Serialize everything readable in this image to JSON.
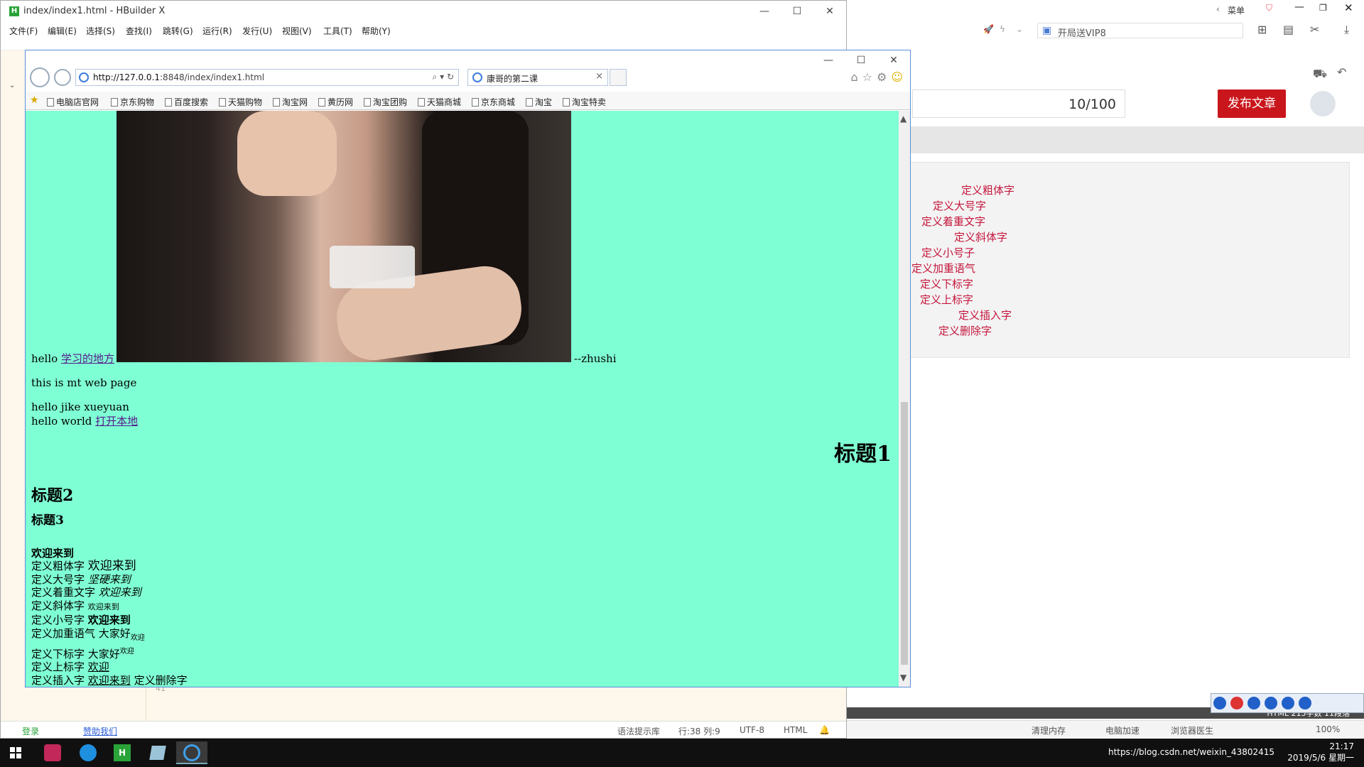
{
  "hbuilder": {
    "title": "index/index1.html - HBuilder X",
    "menu": [
      "文件(F)",
      "编辑(E)",
      "选择(S)",
      "查找(I)",
      "跳转(G)",
      "运行(R)",
      "发行(U)",
      "视图(V)",
      "工具(T)",
      "帮助(Y)"
    ],
    "line_number": "41",
    "status": {
      "login": "登录",
      "support": "赞助我们",
      "hint": "语法提示库",
      "pos": "行:38  列:9",
      "encoding": "UTF-8",
      "lang": "HTML"
    }
  },
  "browser": {
    "url_host": "http://127.0.0.1",
    "url_rest": ":8848/index/index1.html",
    "tab_title": "康哥的第二课",
    "favorites": [
      "电脑店官网",
      "京东购物",
      "百度搜索",
      "天猫购物",
      "淘宝网",
      "黄历网",
      "淘宝团购",
      "天猫商城",
      "京东商城",
      "淘宝",
      "淘宝特卖"
    ]
  },
  "page": {
    "hello": "hello",
    "link_study": "学习的地方",
    "zhushi": "--zhushi",
    "line1": "this is mt web page",
    "line2": "hello jike xueyuan",
    "line3": "hello world",
    "link_local": "打开本地",
    "h1": "标题1",
    "h2": "标题2",
    "h3": "标题3",
    "welcome_bold": "欢迎来到",
    "rows": [
      {
        "label": "定义粗体字",
        "value": "欢迎来到"
      },
      {
        "label": "定义大号字",
        "value": "坚硬来到"
      },
      {
        "label": "定义着重文字",
        "value": "欢迎来到"
      },
      {
        "label": "定义斜体字",
        "value": "欢迎来到"
      },
      {
        "label": "定义小号字",
        "value": "欢迎来到"
      },
      {
        "label": "定义加重语气",
        "value": "大家好",
        "sub": "欢迎"
      },
      {
        "label": "定义下标字",
        "value": "大家好",
        "sup": "欢迎"
      },
      {
        "label": "定义上标字",
        "value": "欢迎"
      },
      {
        "label": "定义插入字",
        "value": "欢迎来到",
        "extra": "定义删除字"
      }
    ]
  },
  "rightapp": {
    "menu_label": "菜单",
    "search_text": "开局送VIP8",
    "counter": "10/100",
    "publish": "发布文章",
    "list": [
      "定义粗体字",
      "定义大号字",
      "定义着重文字",
      "定义斜体字",
      "定义小号子",
      "定义加重语气",
      "定义下标字",
      "定义上标字",
      "定义插入字",
      "定义删除字"
    ],
    "status": {
      "clean": "清理内存",
      "speed": "电脑加速",
      "doctor": "浏览器医生",
      "zoom": "100%"
    },
    "dark_text": "HTML  215字数  11段落"
  },
  "taskbar": {
    "time": "21:17",
    "date": "2019/5/6 星期一",
    "watermark": "https://blog.csdn.net/weixin_43802415"
  },
  "colors": {
    "page_bg": "#7fffd4",
    "publish": "#c9161c",
    "list_text": "#c5163c",
    "link": "#551a8b"
  }
}
